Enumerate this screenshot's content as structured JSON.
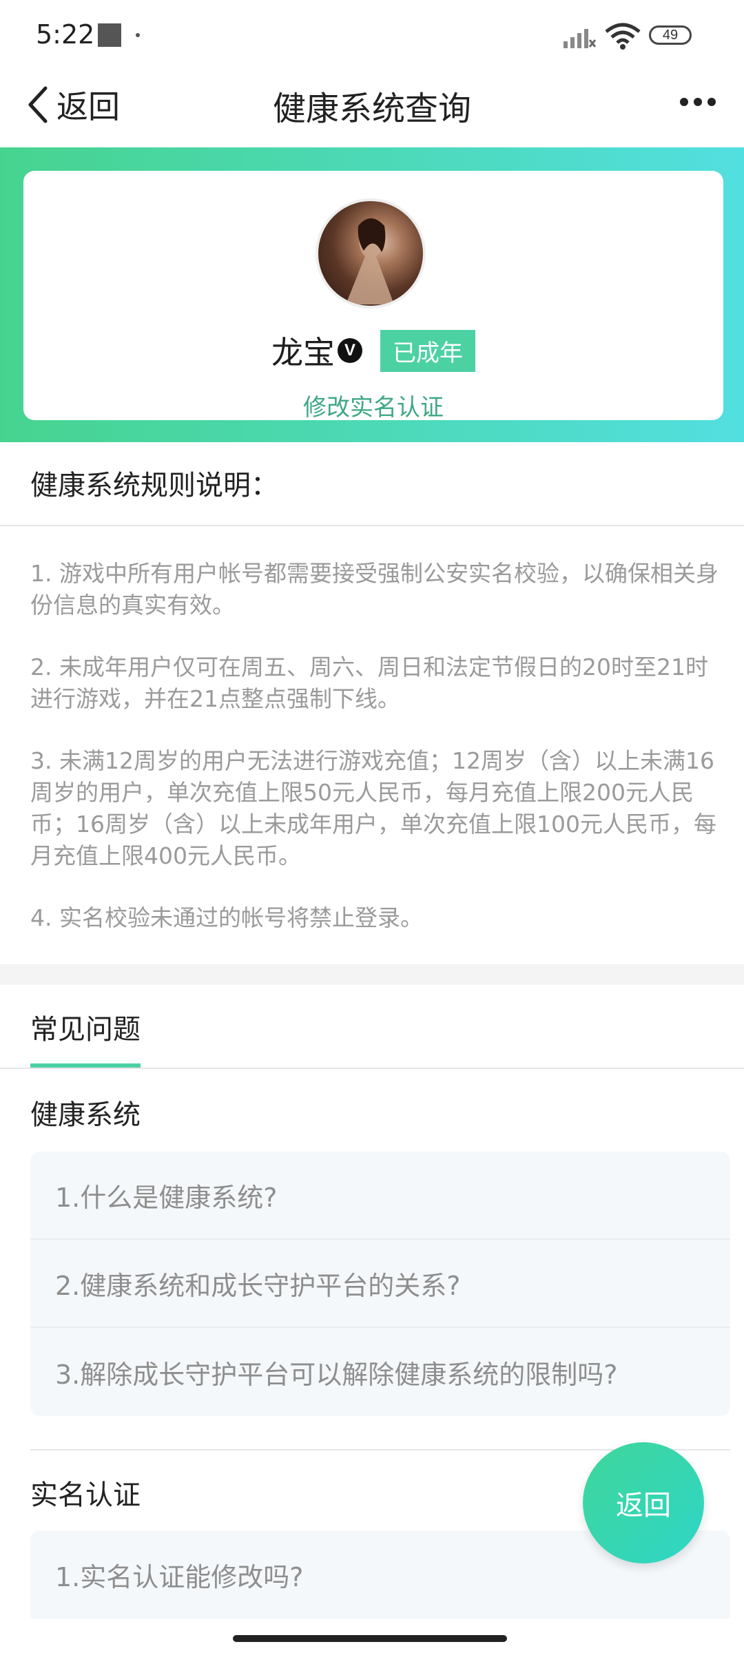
{
  "status_bar": {
    "time": "5:22",
    "battery": "49"
  },
  "nav": {
    "back_label": "返回",
    "title": "健康系统查询"
  },
  "profile": {
    "name": "龙宝",
    "verified_mark": "V",
    "badge": "已成年",
    "modify_link": "修改实名认证"
  },
  "rules": {
    "heading": "健康系统规则说明：",
    "items": [
      "1. 游戏中所有用户帐号都需要接受强制公安实名校验，以确保相关身份信息的真实有效。",
      "2. 未成年用户仅可在周五、周六、周日和法定节假日的20时至21时进行游戏，并在21点整点强制下线。",
      "3. 未满12周岁的用户无法进行游戏充值；12周岁（含）以上未满16周岁的用户，单次充值上限50元人民币，每月充值上限200元人民币；16周岁（含）以上未成年用户，单次充值上限100元人民币，每月充值上限400元人民币。",
      "4. 实名校验未通过的帐号将禁止登录。"
    ]
  },
  "faq": {
    "tab": "常见问题",
    "groups": [
      {
        "title": "健康系统",
        "items": [
          "1.什么是健康系统?",
          "2.健康系统和成长守护平台的关系?",
          "3.解除成长守护平台可以解除健康系统的限制吗?"
        ]
      },
      {
        "title": "实名认证",
        "items": [
          "1.实名认证能修改吗?"
        ]
      }
    ]
  },
  "float_button": {
    "label": "返回"
  },
  "colors": {
    "accent": "#4cd1a3",
    "link": "#3fa883",
    "gradient_start": "#47d38f",
    "gradient_end": "#52dfe0"
  }
}
